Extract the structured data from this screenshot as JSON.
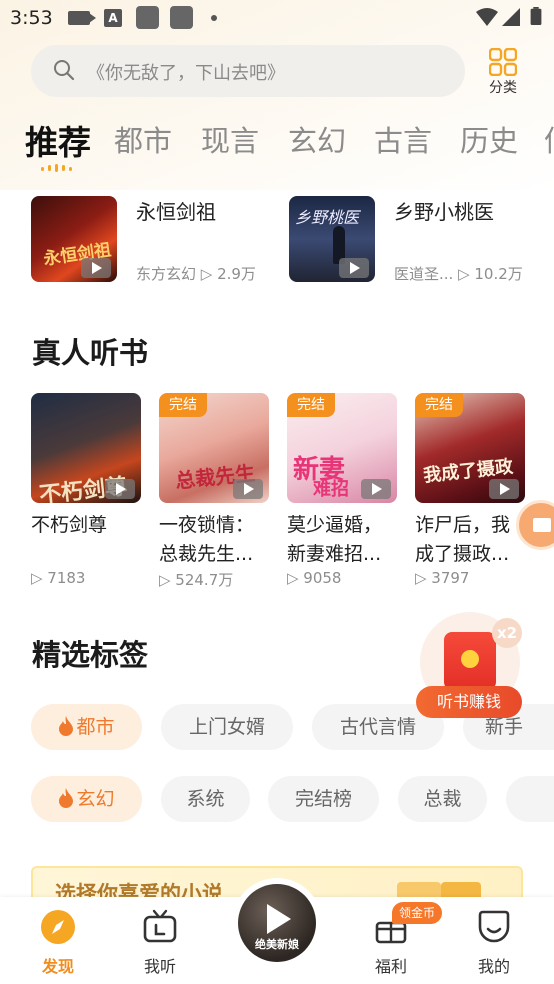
{
  "status_bar": {
    "time": "3:53"
  },
  "search": {
    "placeholder": "《你无敌了，下山去吧》"
  },
  "category": {
    "label": "分类"
  },
  "tabs": [
    "推荐",
    "都市",
    "现言",
    "玄幻",
    "古言",
    "历史",
    "仙"
  ],
  "top_books": [
    {
      "title": "永恒剑祖",
      "meta": "东方玄幻 ▷ 2.9万"
    },
    {
      "title": "乡野小桃医",
      "meta": "医道圣... ▷ 10.2万"
    }
  ],
  "audiobooks": {
    "title": "真人听书",
    "items": [
      {
        "name": "不朽剑尊",
        "count": "▷ 7183",
        "badge": ""
      },
      {
        "name": "一夜锁情：总裁先生...",
        "count": "▷ 524.7万",
        "badge": "完结"
      },
      {
        "name": "莫少逼婚，新妻难招...",
        "count": "▷ 9058",
        "badge": "完结"
      },
      {
        "name": "诈尸后，我成了摄政...",
        "count": "▷ 3797",
        "badge": "完结"
      }
    ]
  },
  "tags": {
    "title": "精选标签",
    "row1": [
      "都市",
      "上门女婿",
      "古代言情",
      "新手"
    ],
    "row2": [
      "玄幻",
      "系统",
      "完结榜",
      "总裁"
    ]
  },
  "red_packet": {
    "multiplier": "x2",
    "label": "听书赚钱"
  },
  "banner": {
    "text": "选择你喜爱的小说"
  },
  "nav": {
    "discover": "发现",
    "listen": "我听",
    "welfare": "福利",
    "mine": "我的",
    "coin_badge": "领金币",
    "player_caption": "绝美新娘"
  },
  "colors": {
    "accent": "#f08d1e",
    "tag_hot_bg": "#fdeede",
    "badge_orange": "#f4901e"
  }
}
